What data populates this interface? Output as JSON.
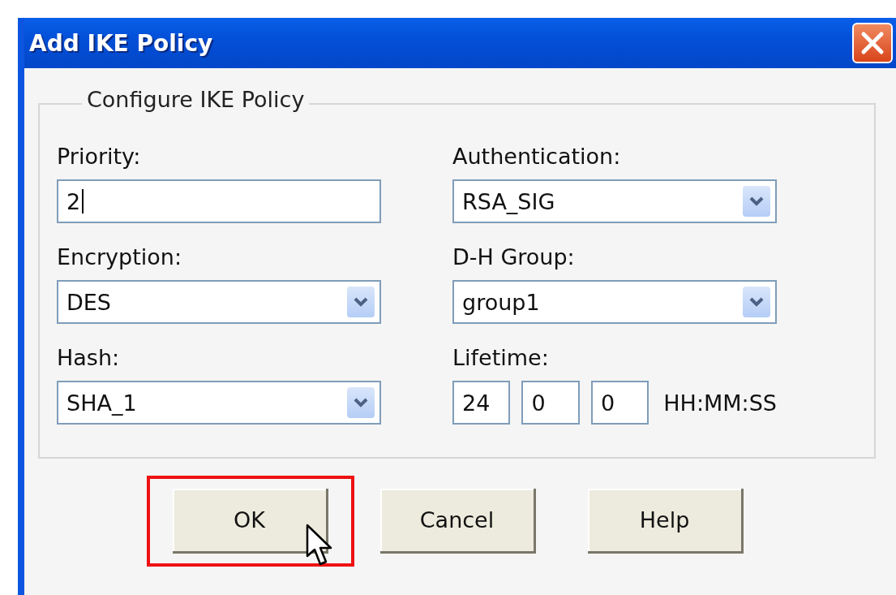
{
  "window": {
    "title": "Add IKE Policy"
  },
  "group": {
    "title": "Configure IKE Policy"
  },
  "fields": [
    {
      "kind": "text",
      "label": "Priority:",
      "value": "2"
    },
    {
      "kind": "select",
      "label": "Authentication:",
      "value": "RSA_SIG"
    },
    {
      "kind": "select",
      "label": "Encryption:",
      "value": "DES"
    },
    {
      "kind": "select",
      "label": "D-H Group:",
      "value": "group1"
    },
    {
      "kind": "select",
      "label": "Hash:",
      "value": "SHA_1"
    },
    {
      "kind": "lifetime",
      "label": "Lifetime:",
      "parts": [
        "24",
        "0",
        "0"
      ],
      "unit": "HH:MM:SS"
    }
  ],
  "buttons": [
    {
      "label": "OK",
      "highlighted": true
    },
    {
      "label": "Cancel",
      "highlighted": false
    },
    {
      "label": "Help",
      "highlighted": false
    }
  ]
}
